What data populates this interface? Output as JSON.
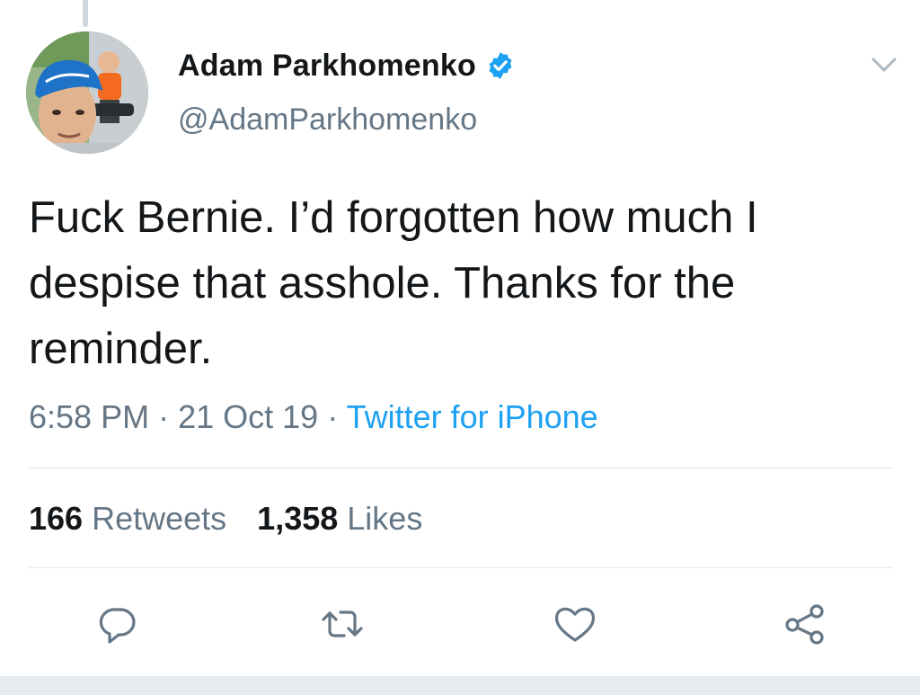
{
  "author": {
    "display_name": "Adam Parkhomenko",
    "handle": "@AdamParkhomenko",
    "verified": true
  },
  "tweet": {
    "text": "Fuck Bernie. I’d forgotten how much I despise that asshole. Thanks for the reminder.",
    "time": "6:58 PM",
    "date": "21 Oct 19",
    "separator": "·",
    "source": "Twitter for iPhone"
  },
  "stats": {
    "retweets_count": "166",
    "retweets_label": "Retweets",
    "likes_count": "1,358",
    "likes_label": "Likes"
  },
  "icons": {
    "verified": "verified-badge-icon",
    "menu": "chevron-down-icon",
    "reply": "reply-icon",
    "retweet": "retweet-icon",
    "like": "heart-icon",
    "share": "share-icon"
  },
  "colors": {
    "accent": "#1da1f2",
    "text": "#14171a",
    "secondary": "#657786",
    "divider": "#e1e8ed"
  }
}
